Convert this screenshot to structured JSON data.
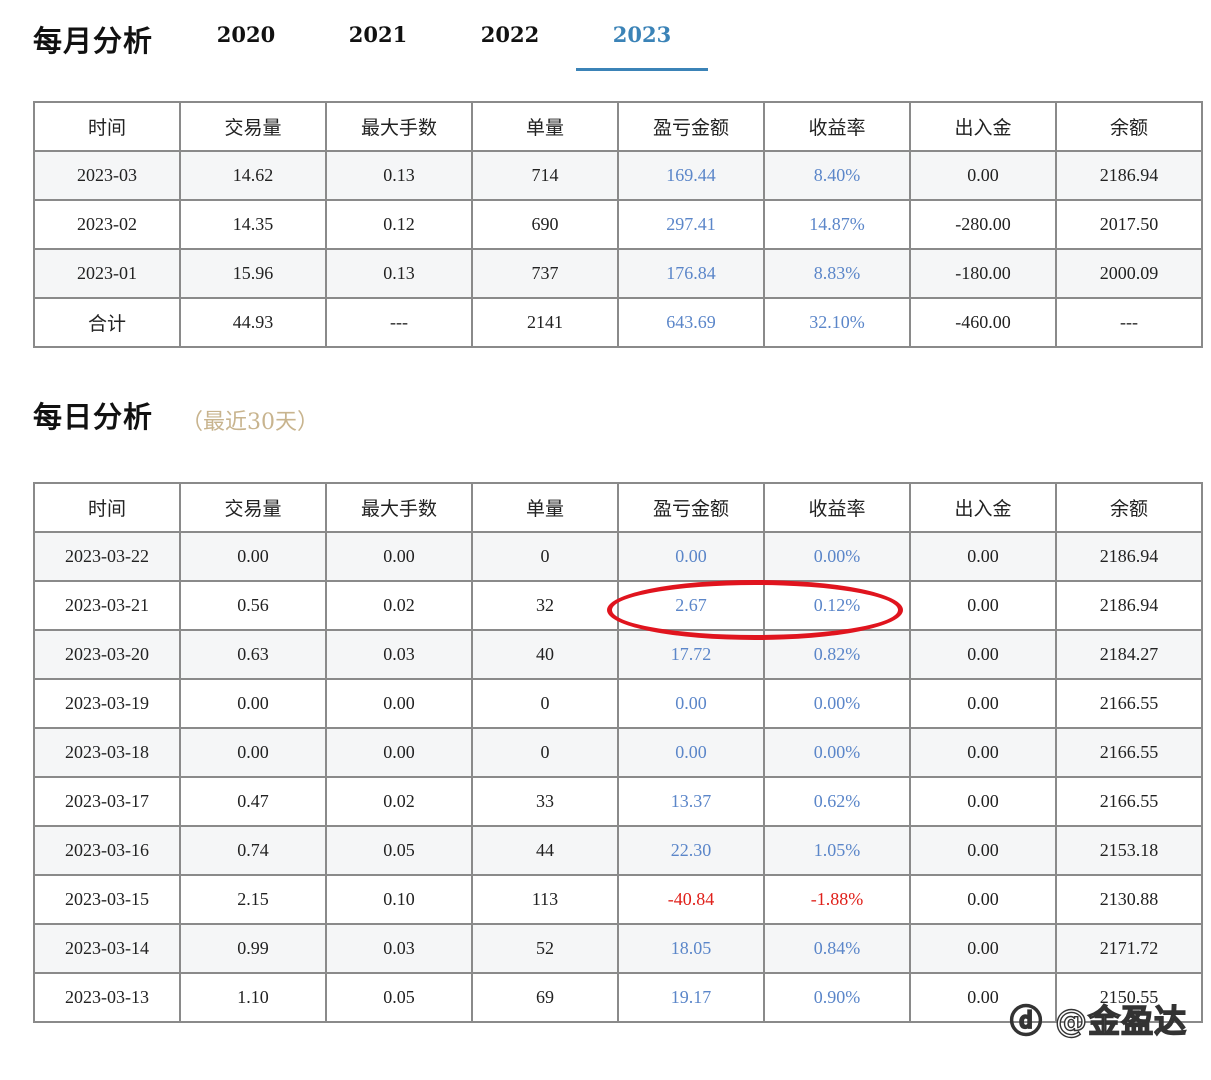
{
  "monthly": {
    "title": "每月分析",
    "year_tabs": [
      "2020",
      "2021",
      "2022",
      "2023"
    ],
    "active_year": "2023",
    "headers": [
      "时间",
      "交易量",
      "最大手数",
      "单量",
      "盈亏金额",
      "收益率",
      "出入金",
      "余额"
    ],
    "rows": [
      [
        "2023-03",
        "14.62",
        "0.13",
        "714",
        "169.44",
        "8.40%",
        "0.00",
        "2186.94"
      ],
      [
        "2023-02",
        "14.35",
        "0.12",
        "690",
        "297.41",
        "14.87%",
        "-280.00",
        "2017.50"
      ],
      [
        "2023-01",
        "15.96",
        "0.13",
        "737",
        "176.84",
        "8.83%",
        "-180.00",
        "2000.09"
      ],
      [
        "合计",
        "44.93",
        "---",
        "2141",
        "643.69",
        "32.10%",
        "-460.00",
        "---"
      ]
    ]
  },
  "daily": {
    "title": "每日分析",
    "subtitle": "（最近30天）",
    "headers": [
      "时间",
      "交易量",
      "最大手数",
      "单量",
      "盈亏金额",
      "收益率",
      "出入金",
      "余额"
    ],
    "rows": [
      [
        "2023-03-22",
        "0.00",
        "0.00",
        "0",
        "0.00",
        "0.00%",
        "0.00",
        "2186.94"
      ],
      [
        "2023-03-21",
        "0.56",
        "0.02",
        "32",
        "2.67",
        "0.12%",
        "0.00",
        "2186.94"
      ],
      [
        "2023-03-20",
        "0.63",
        "0.03",
        "40",
        "17.72",
        "0.82%",
        "0.00",
        "2184.27"
      ],
      [
        "2023-03-19",
        "0.00",
        "0.00",
        "0",
        "0.00",
        "0.00%",
        "0.00",
        "2166.55"
      ],
      [
        "2023-03-18",
        "0.00",
        "0.00",
        "0",
        "0.00",
        "0.00%",
        "0.00",
        "2166.55"
      ],
      [
        "2023-03-17",
        "0.47",
        "0.02",
        "33",
        "13.37",
        "0.62%",
        "0.00",
        "2166.55"
      ],
      [
        "2023-03-16",
        "0.74",
        "0.05",
        "44",
        "22.30",
        "1.05%",
        "0.00",
        "2153.18"
      ],
      [
        "2023-03-15",
        "2.15",
        "0.10",
        "113",
        "-40.84",
        "-1.88%",
        "0.00",
        "2130.88"
      ],
      [
        "2023-03-14",
        "0.99",
        "0.03",
        "52",
        "18.05",
        "0.84%",
        "0.00",
        "2171.72"
      ],
      [
        "2023-03-13",
        "1.10",
        "0.05",
        "69",
        "19.17",
        "0.90%",
        "0.00",
        "2150.55"
      ]
    ]
  },
  "colors": {
    "accent_blue": "#3b83b7",
    "positive_value": "#5b86c9",
    "negative_value": "#e0201a",
    "highlight_ellipse": "#e0141e",
    "subtitle": "#c8b48e"
  },
  "watermark": "金盈达"
}
